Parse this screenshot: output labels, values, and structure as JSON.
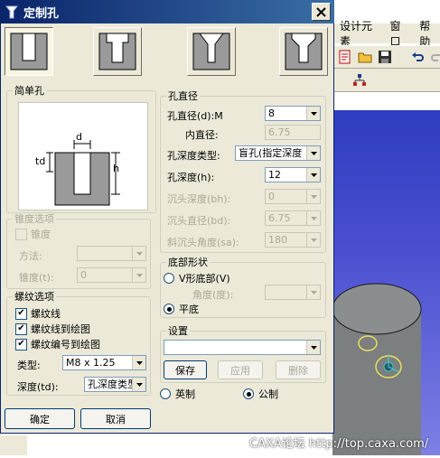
{
  "dialog": {
    "title": "定制孔",
    "title_icon": "countersink-icon",
    "hole_types": [
      {
        "name": "simple-hole",
        "selected": true
      },
      {
        "name": "counterbore-hole",
        "selected": false
      },
      {
        "name": "countersink-hole",
        "selected": false
      },
      {
        "name": "counterbore-countersink-hole",
        "selected": false
      }
    ]
  },
  "simple_hole_group": {
    "legend": "简单孔",
    "diagram_labels": {
      "d": "d",
      "td": "td",
      "h": "h"
    }
  },
  "taper_group": {
    "legend": "锥度选项",
    "taper_checkbox": "锥度",
    "method_label": "方法:",
    "method_value": "",
    "taper_label": "锥度(t):",
    "taper_value": "0"
  },
  "thread_group": {
    "legend": "螺纹选项",
    "thread_line": "螺纹线",
    "thread_to_drawing": "螺纹线到绘图",
    "thread_number_to_drawing": "螺纹编号到绘图",
    "type_label": "类型:",
    "type_value": "M8 x 1.25",
    "depth_label": "深度(td):",
    "depth_value": "孔深度类型"
  },
  "diameter_group": {
    "legend": "孔直径",
    "hole_diameter_label": "孔直径(d):M",
    "hole_diameter_value": "8",
    "inner_diameter_label": "内直径:",
    "inner_diameter_value": "6.75",
    "depth_type_label": "孔深度类型:",
    "depth_type_value": "盲孔(指定深度",
    "depth_label": "孔深度(h):",
    "depth_value": "12",
    "cb_depth_label": "沉头深度(bh):",
    "cb_depth_value": "0",
    "cb_diameter_label": "沉头直径(bd):",
    "cb_diameter_value": "6.75",
    "cs_angle_label": "斜沉头角度(sa):",
    "cs_angle_value": "180"
  },
  "bottom_group": {
    "legend": "底部形状",
    "v_bottom": "V形底部(V)",
    "angle_label": "角度(度):",
    "flat": "平底",
    "selected": "flat"
  },
  "settings_group": {
    "legend": "设置",
    "settings_value": "",
    "save": "保存",
    "apply": "应用",
    "delete": "删除"
  },
  "units": {
    "imperial": "英制",
    "metric": "公制",
    "selected": "metric"
  },
  "actions": {
    "ok": "确定",
    "cancel": "取消"
  },
  "app": {
    "menu": [
      "设计元素",
      "窗口",
      "帮助"
    ],
    "watermark": "CAXA论坛 http://top.caxa.com/"
  }
}
